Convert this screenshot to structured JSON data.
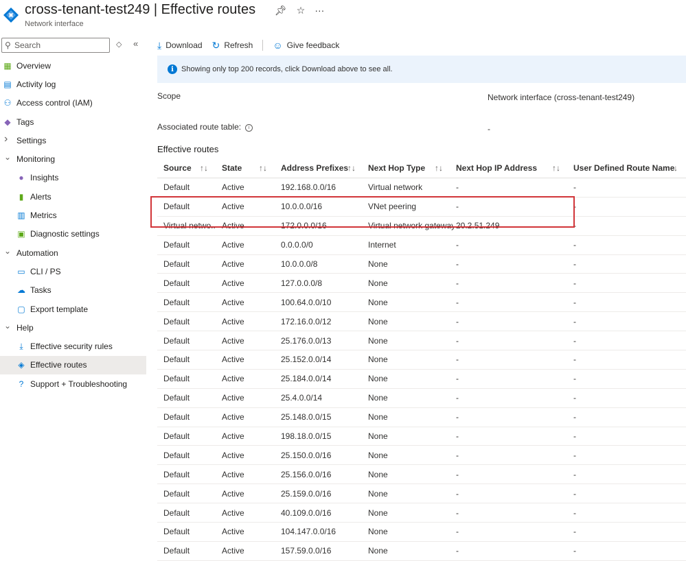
{
  "header": {
    "title": "cross-tenant-test249 | Effective routes",
    "subtitle": "Network interface",
    "pin_icon": "pin-icon",
    "star_icon": "star-icon",
    "more_label": "···"
  },
  "sidebar": {
    "search_placeholder": "Search",
    "collapse_label": "«",
    "items": [
      {
        "label": "Overview",
        "icon": "overview-icon",
        "level": 0
      },
      {
        "label": "Activity log",
        "icon": "activity-log-icon",
        "level": 0
      },
      {
        "label": "Access control (IAM)",
        "icon": "iam-icon",
        "level": 0
      },
      {
        "label": "Tags",
        "icon": "tag-icon",
        "level": 0
      },
      {
        "label": "Settings",
        "icon": "chevron-right-icon",
        "level": 0,
        "group": true
      },
      {
        "label": "Monitoring",
        "icon": "chevron-down-icon",
        "level": 0,
        "group": true
      },
      {
        "label": "Insights",
        "icon": "insights-icon",
        "level": 1
      },
      {
        "label": "Alerts",
        "icon": "alerts-icon",
        "level": 1
      },
      {
        "label": "Metrics",
        "icon": "metrics-icon",
        "level": 1
      },
      {
        "label": "Diagnostic settings",
        "icon": "diagnostic-settings-icon",
        "level": 1
      },
      {
        "label": "Automation",
        "icon": "chevron-down-icon",
        "level": 0,
        "group": true
      },
      {
        "label": "CLI / PS",
        "icon": "cli-icon",
        "level": 1
      },
      {
        "label": "Tasks",
        "icon": "tasks-icon",
        "level": 1
      },
      {
        "label": "Export template",
        "icon": "export-template-icon",
        "level": 1
      },
      {
        "label": "Help",
        "icon": "chevron-down-icon",
        "level": 0,
        "group": true
      },
      {
        "label": "Effective security rules",
        "icon": "security-rules-icon",
        "level": 1
      },
      {
        "label": "Effective routes",
        "icon": "routes-icon",
        "level": 1,
        "selected": true
      },
      {
        "label": "Support + Troubleshooting",
        "icon": "help-icon",
        "level": 1
      }
    ]
  },
  "toolbar": {
    "download_label": "Download",
    "refresh_label": "Refresh",
    "feedback_label": "Give feedback"
  },
  "info": {
    "message": "Showing only top 200 records, click Download above to see all."
  },
  "properties": {
    "scope_label": "Scope",
    "scope_value": "Network interface (cross-tenant-test249)",
    "route_table_label": "Associated route table:",
    "route_table_value": "-"
  },
  "routes": {
    "section_title": "Effective routes",
    "columns": [
      "Source",
      "State",
      "Address Prefixes",
      "Next Hop Type",
      "Next Hop IP Address",
      "User Defined Route Name"
    ],
    "sort_glyph": "↑↓",
    "rows": [
      [
        "Default",
        "Active",
        "192.168.0.0/16",
        "Virtual network",
        "-",
        "-"
      ],
      [
        "Default",
        "Active",
        "10.0.0.0/16",
        "VNet peering",
        "-",
        "-"
      ],
      [
        "Virtual netwo...",
        "Active",
        "172.0.0.0/16",
        "Virtual network gateway",
        "20.2.51.249",
        "-"
      ],
      [
        "Default",
        "Active",
        "0.0.0.0/0",
        "Internet",
        "-",
        "-"
      ],
      [
        "Default",
        "Active",
        "10.0.0.0/8",
        "None",
        "-",
        "-"
      ],
      [
        "Default",
        "Active",
        "127.0.0.0/8",
        "None",
        "-",
        "-"
      ],
      [
        "Default",
        "Active",
        "100.64.0.0/10",
        "None",
        "-",
        "-"
      ],
      [
        "Default",
        "Active",
        "172.16.0.0/12",
        "None",
        "-",
        "-"
      ],
      [
        "Default",
        "Active",
        "25.176.0.0/13",
        "None",
        "-",
        "-"
      ],
      [
        "Default",
        "Active",
        "25.152.0.0/14",
        "None",
        "-",
        "-"
      ],
      [
        "Default",
        "Active",
        "25.184.0.0/14",
        "None",
        "-",
        "-"
      ],
      [
        "Default",
        "Active",
        "25.4.0.0/14",
        "None",
        "-",
        "-"
      ],
      [
        "Default",
        "Active",
        "25.148.0.0/15",
        "None",
        "-",
        "-"
      ],
      [
        "Default",
        "Active",
        "198.18.0.0/15",
        "None",
        "-",
        "-"
      ],
      [
        "Default",
        "Active",
        "25.150.0.0/16",
        "None",
        "-",
        "-"
      ],
      [
        "Default",
        "Active",
        "25.156.0.0/16",
        "None",
        "-",
        "-"
      ],
      [
        "Default",
        "Active",
        "25.159.0.0/16",
        "None",
        "-",
        "-"
      ],
      [
        "Default",
        "Active",
        "40.109.0.0/16",
        "None",
        "-",
        "-"
      ],
      [
        "Default",
        "Active",
        "104.147.0.0/16",
        "None",
        "-",
        "-"
      ],
      [
        "Default",
        "Active",
        "157.59.0.0/16",
        "None",
        "-",
        "-"
      ]
    ]
  },
  "colors": {
    "accent": "#0078d4",
    "highlight_border": "#d13438",
    "info_bg": "#ebf3fc",
    "selected_bg": "#edebe9"
  }
}
